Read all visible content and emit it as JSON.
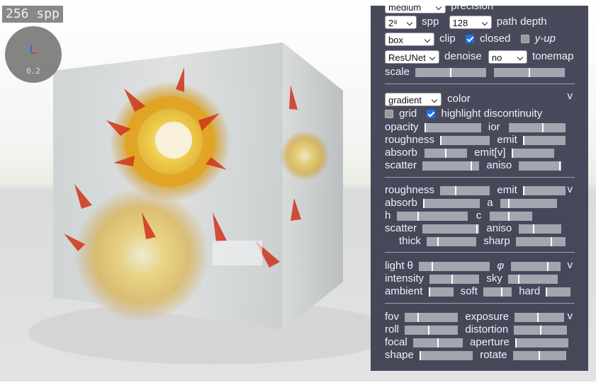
{
  "status": {
    "spp": "256 spp"
  },
  "gizmo": {
    "value": "0.2"
  },
  "panel": {
    "top": {
      "precision_select": "medium",
      "precision_label": "precision",
      "spp_select": "2⁸",
      "spp_label": "spp",
      "depth_select": "128",
      "depth_label": "path depth",
      "clip_select": "box",
      "clip_label": "clip",
      "closed_label": "closed",
      "closed_checked": true,
      "yup_label": "y-up",
      "yup_checked": false,
      "denoise_select": "ResUNet",
      "denoise_label": "denoise",
      "tonemap_select": "no",
      "tonemap_label": "tonemap",
      "scale_label": "scale",
      "scale_values": [
        0.5,
        0.5
      ]
    },
    "surface": {
      "color_select": "gradient",
      "color_label": "color",
      "toggle": "v",
      "grid_label": "grid",
      "grid_checked": false,
      "highlight_label": "highlight discontinuity",
      "highlight_checked": true,
      "opacity_label": "opacity",
      "opacity": 0.0,
      "ior_label": "ior",
      "ior": 0.6,
      "roughness_label": "roughness",
      "roughness": 0.0,
      "emit_label": "emit",
      "emit": 0.0,
      "absorb_label": "absorb",
      "absorb": 0.5,
      "emitv_label": "emit[v]",
      "emitv": 0.0,
      "scatter_label": "scatter",
      "scatter": 0.87,
      "aniso_label": "aniso",
      "aniso": 0.97
    },
    "material2": {
      "toggle": "v",
      "roughness_label": "roughness",
      "roughness": 0.3,
      "emit_label": "emit",
      "emit": 0.0,
      "absorb_label": "absorb",
      "absorb": 0.0,
      "a_label": "a",
      "a": 0.15,
      "h_label": "h",
      "h": 0.3,
      "c_label": "c",
      "c": 0.45,
      "scatter_label": "scatter",
      "scatter": 0.97,
      "aniso_label": "aniso",
      "aniso": 0.33,
      "thick_label": "thick",
      "thick": 0.22,
      "sharp_label": "sharp",
      "sharp": 0.72
    },
    "light": {
      "toggle": "v",
      "theta_label": "light θ",
      "theta": 0.18,
      "phi_label": "φ",
      "phi": 0.75,
      "intensity_label": "intensity",
      "intensity": 0.45,
      "sky_label": "sky",
      "sky": 0.2,
      "ambient_label": "ambient",
      "ambient": 0.0,
      "soft_label": "soft",
      "soft": 0.65,
      "hard_label": "hard",
      "hard": 0.0
    },
    "camera": {
      "toggle": "v",
      "fov_label": "fov",
      "fov": 0.25,
      "exposure_label": "exposure",
      "exposure": 0.47,
      "roll_label": "roll",
      "roll": 0.45,
      "distortion_label": "distortion",
      "distortion": 0.5,
      "focal_label": "focal",
      "focal": 0.5,
      "aperture_label": "aperture",
      "aperture": 0.0,
      "shape_label": "shape",
      "shape": 0.0,
      "rotate_label": "rotate",
      "rotate": 0.5
    }
  }
}
